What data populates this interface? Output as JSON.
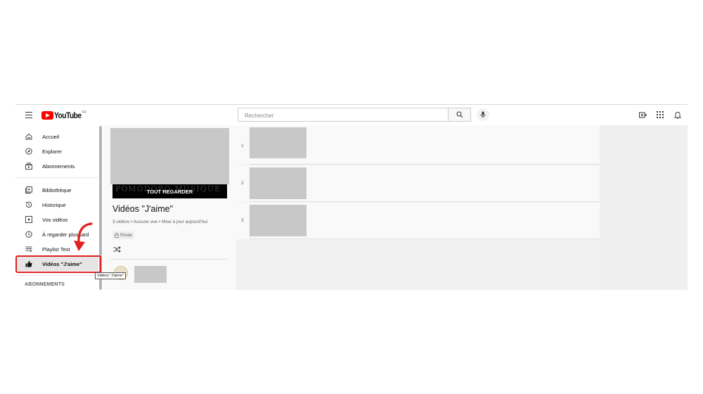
{
  "header": {
    "logo_text": "YouTube",
    "country": "FR",
    "search_placeholder": "Rechercher"
  },
  "sidebar": {
    "items": [
      {
        "label": "Accueil",
        "icon": "home-icon"
      },
      {
        "label": "Explorer",
        "icon": "compass-icon"
      },
      {
        "label": "Abonnements",
        "icon": "subscriptions-icon"
      },
      {
        "label": "Bibliothèque",
        "icon": "library-icon"
      },
      {
        "label": "Historique",
        "icon": "history-icon"
      },
      {
        "label": "Vos vidéos",
        "icon": "your-videos-icon"
      },
      {
        "label": "À regarder plus tard",
        "icon": "watch-later-icon"
      },
      {
        "label": "Playlist Test",
        "icon": "playlist-icon"
      },
      {
        "label": "Vidéos \"J'aime\"",
        "icon": "thumbs-up-icon"
      }
    ],
    "section_label": "ABONNEMENTS",
    "tooltip": "Vidéos \"J'aime\""
  },
  "playlist": {
    "ghost_text": "POMODORO MUSIQUE",
    "play_all": "TOUT REGARDER",
    "title": "Vidéos \"J'aime\"",
    "meta": "3 vidéos • Aucune vue • Mise à jour aujourd'hui",
    "privacy": "Privée"
  },
  "videos": [
    {
      "index": "1"
    },
    {
      "index": "2"
    },
    {
      "index": "3"
    }
  ],
  "colors": {
    "brand_red": "#ff0000",
    "highlight_red": "#e02020",
    "thumbnail_gray": "#c8c8c8"
  }
}
